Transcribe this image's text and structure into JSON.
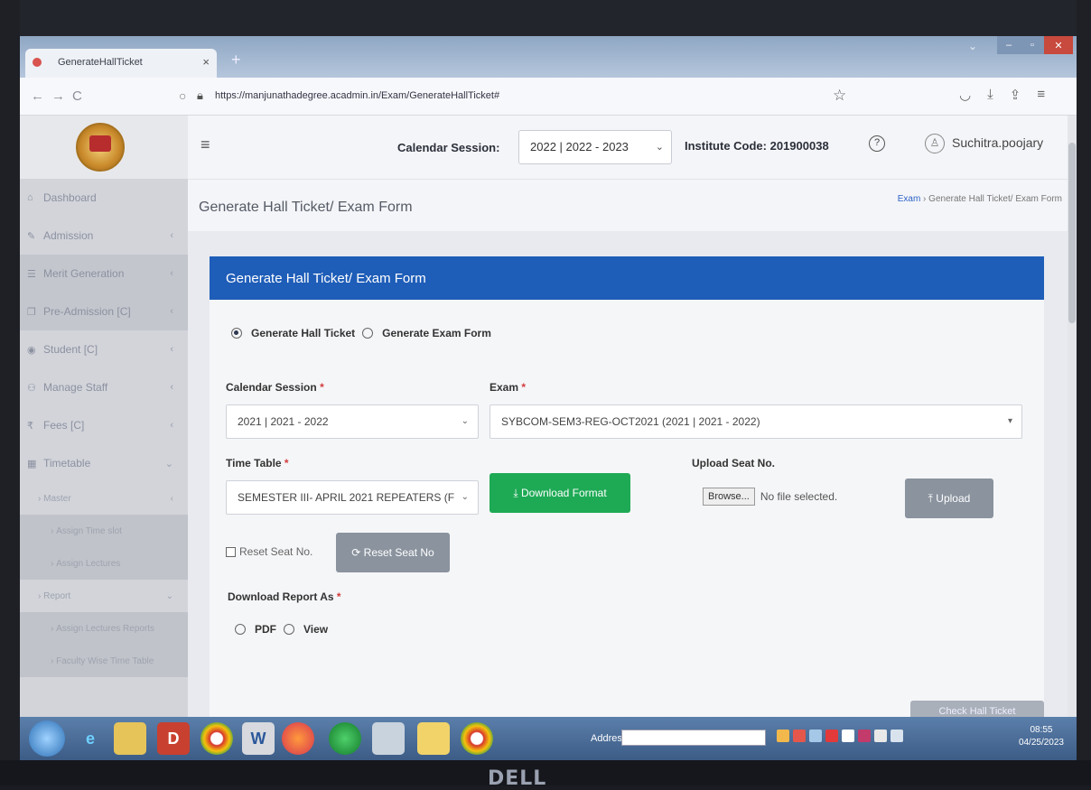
{
  "browser": {
    "tab_title": "GenerateHallTicket",
    "tab_close": "×",
    "new_tab": "+",
    "url": "https://manjunathadegree.acadmin.in/Exam/GenerateHallTicket#"
  },
  "header": {
    "menu_icon": "≡",
    "calendar_session_label": "Calendar Session:",
    "calendar_session_value": "2022 | 2022 - 2023",
    "institute_code": "Institute Code: 201900038",
    "user_name": "Suchitra.poojary"
  },
  "sidebar": {
    "items": [
      {
        "label": "Dashboard",
        "icon": "home-icon"
      },
      {
        "label": "Admission",
        "icon": "edit-icon"
      },
      {
        "label": "Merit Generation",
        "icon": "list-icon"
      },
      {
        "label": "Pre-Admission [C]",
        "icon": "copy-icon"
      },
      {
        "label": "Student [C]",
        "icon": "user-circle-icon"
      },
      {
        "label": "Manage Staff",
        "icon": "users-icon"
      },
      {
        "label": "Fees [C]",
        "icon": "rupee-icon"
      },
      {
        "label": "Timetable",
        "icon": "calendar-icon"
      }
    ],
    "sub_items": [
      {
        "label": "Master"
      },
      {
        "label": "Assign Time slot"
      },
      {
        "label": "Assign Lectures"
      },
      {
        "label": "Report"
      },
      {
        "label": "Assign Lectures Reports"
      },
      {
        "label": "Faculty Wise Time Table"
      }
    ]
  },
  "page": {
    "title": "Generate Hall Ticket/ Exam Form",
    "breadcrumb_exam": "Exam",
    "breadcrumb_sep": " › ",
    "breadcrumb_current": "Generate Hall Ticket/ Exam Form"
  },
  "form": {
    "card_title": "Generate Hall Ticket/ Exam Form",
    "radio_hall_ticket": "Generate Hall Ticket",
    "radio_exam_form": "Generate Exam Form",
    "calendar_session_label": "Calendar Session",
    "calendar_session_value": "2021 | 2021 - 2022",
    "exam_label": "Exam",
    "exam_value": "SYBCOM-SEM3-REG-OCT2021 (2021 | 2021 - 2022)",
    "time_table_label": "Time Table",
    "time_table_value": "SEMESTER III- APRIL 2021 REPEATERS (F",
    "download_format": "Download Format",
    "upload_seat_label": "Upload Seat No.",
    "browse": "Browse...",
    "no_file": "No file selected.",
    "upload": "Upload",
    "reset_seat_checkbox": "Reset Seat No.",
    "reset_seat_button": "Reset Seat No",
    "download_report_label": "Download Report As",
    "radio_pdf": "PDF",
    "radio_view": "View",
    "required_mark": "*",
    "bottom_button": "Check Hall Ticket"
  },
  "taskbar": {
    "address_label": "Address",
    "time": "08:55",
    "date": "04/25/2023"
  },
  "bezel": {
    "brand": "DELL"
  },
  "colors": {
    "primary_blue": "#1e5db8",
    "download_green": "#1eaa55",
    "disabled_grey": "#8a939e"
  }
}
